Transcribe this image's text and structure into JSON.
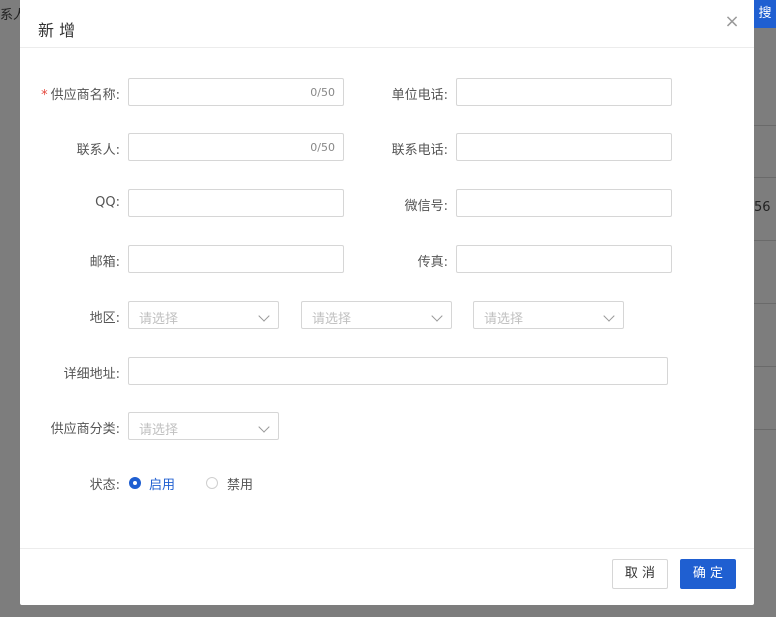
{
  "background": {
    "left_text": "系人:",
    "search_button": "搜",
    "right_text": "56"
  },
  "dialog": {
    "title": "新 增",
    "close_icon": "×",
    "fields": {
      "supplier_name": {
        "label": "供应商名称:",
        "required_mark": "*",
        "value": "",
        "counter": "0/50"
      },
      "company_phone": {
        "label": "单位电话:",
        "value": ""
      },
      "contact_person": {
        "label": "联系人:",
        "value": "",
        "counter": "0/50"
      },
      "contact_phone": {
        "label": "联系电话:",
        "value": ""
      },
      "qq": {
        "label": "QQ:",
        "value": ""
      },
      "wechat": {
        "label": "微信号:",
        "value": ""
      },
      "email": {
        "label": "邮箱:",
        "value": ""
      },
      "fax": {
        "label": "传真:",
        "value": ""
      },
      "region": {
        "label": "地区:",
        "province_placeholder": "请选择",
        "city_placeholder": "请选择",
        "district_placeholder": "请选择"
      },
      "address": {
        "label": "详细地址:",
        "value": ""
      },
      "category": {
        "label": "供应商分类:",
        "placeholder": "请选择"
      },
      "status": {
        "label": "状态:",
        "options": [
          "启用",
          "禁用"
        ],
        "selected": "启用"
      }
    },
    "footer": {
      "cancel_label": "取 消",
      "ok_label": "确 定"
    }
  },
  "colors": {
    "accent": "#1f5fd1",
    "required": "#e5463a",
    "overlay": "#7d7d7d"
  }
}
